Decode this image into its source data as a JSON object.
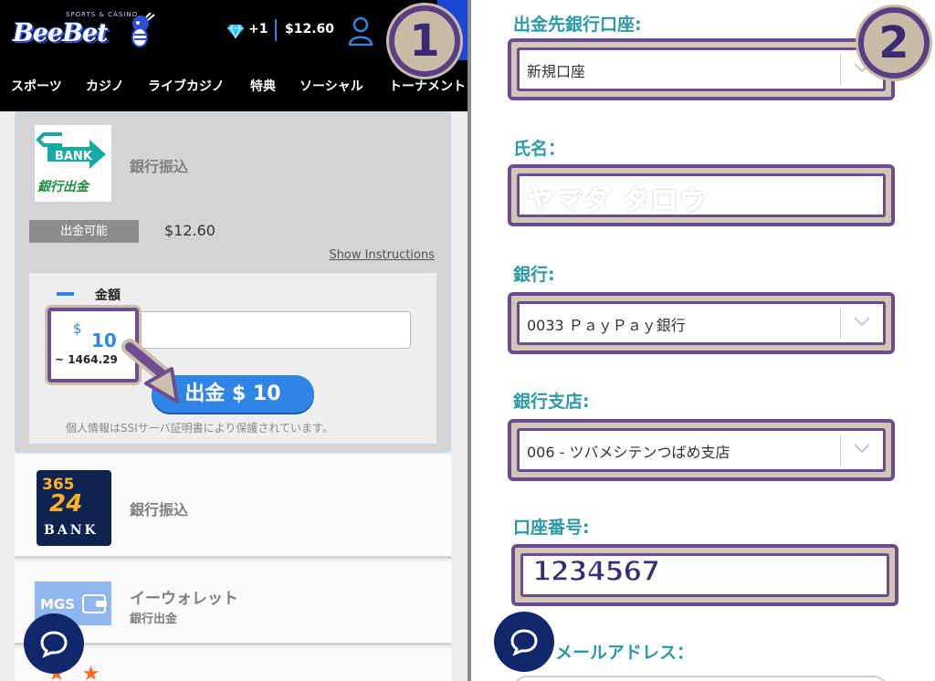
{
  "header": {
    "logo_tag": "SPORTS & CASINO",
    "logo_text": "BeeBet",
    "gems_count": "+1",
    "balance": "$12.60"
  },
  "nav": {
    "items": [
      "スポーツ",
      "カジノ",
      "ライブカジノ",
      "特典",
      "ソーシャル",
      "トーナメント"
    ]
  },
  "withdraw_card": {
    "bank_logo_text": "BANK",
    "bank_logo_caption": "銀行出金",
    "method_name": "銀行振込",
    "available_label": "出金可能",
    "available_amount": "$12.60",
    "show_instructions": "Show Instructions",
    "amount_label": "金額",
    "currency_symbol": "$",
    "amount_value": "10",
    "converted_value": "~ 1464.29",
    "withdraw_button": "出金 $ 10",
    "ssl_note": "個人情報はSSIサーバ証明書により保護されています。"
  },
  "methods": [
    {
      "name": "銀行振込",
      "logo_num1": "365",
      "logo_num2": "24",
      "logo_word": "BANK"
    },
    {
      "name": "イーウォレット",
      "sub": "銀行出金",
      "logo_text": "MGS"
    }
  ],
  "badges": {
    "one": "1",
    "two": "2"
  },
  "form": {
    "bank_account_label": "出金先銀行口座:",
    "bank_account_value": "新規口座",
    "name_label": "氏名：",
    "name_value": "ヤマダ タロウ",
    "bank_label": "銀行:",
    "bank_value": "0033 ＰａｙＰａｙ銀行",
    "branch_label": "銀行支店:",
    "branch_value": "006 - ツバメシテンつばめ支店",
    "account_number_label": "口座番号:",
    "account_number_value": "1234567",
    "email_label": "メールアドレス："
  },
  "colors": {
    "accent_blue": "#2f86e6",
    "label_teal": "#2b9aa8",
    "highlight_purple": "#6a4b94",
    "chat_navy": "#10286b"
  }
}
